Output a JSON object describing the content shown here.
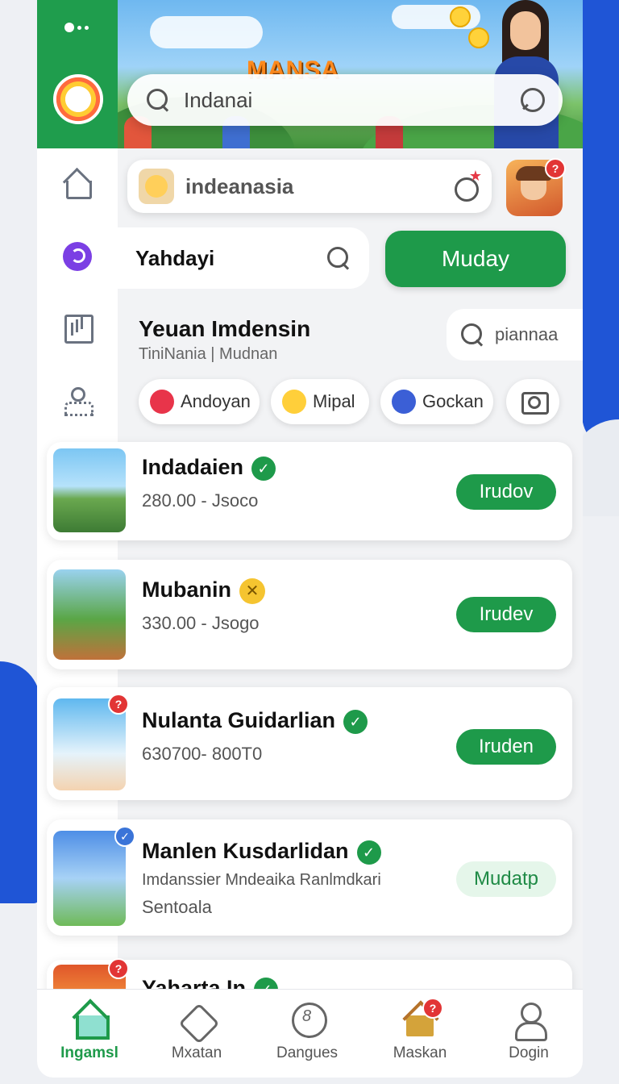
{
  "banner": {
    "title": "MANSA"
  },
  "search": {
    "main_text": "Indanai"
  },
  "featured": {
    "label": "indeanasia",
    "avatar_badge": "?"
  },
  "filter": {
    "label": "Yahdayi",
    "button": "Muday"
  },
  "section": {
    "title": "Yeuan Imdensin",
    "subtitle": "TiniNania | Mudnan",
    "search_text": "piannaa"
  },
  "chips": [
    {
      "label": "Andoyan"
    },
    {
      "label": "Mipal"
    },
    {
      "label": "Gockan"
    }
  ],
  "cards": [
    {
      "name": "Indadaien",
      "meta": "280.00 - Jsoco",
      "action": "Irudov",
      "status": "verified"
    },
    {
      "name": "Mubanin",
      "meta": "330.00 - Jsogo",
      "action": "Irudev",
      "status": "pending"
    },
    {
      "name": "Nulanta Guidarlian",
      "meta": "630700- 800T0",
      "action": "Iruden",
      "status": "verified",
      "badge": "?"
    },
    {
      "name": "Manlen Kusdarlidan",
      "meta": "Imdanssier Mndeaika Ranlmdkari",
      "meta2": "Sentoala",
      "action": "Mudatp",
      "status": "verified"
    },
    {
      "name": "Yaharta In",
      "status": "verified",
      "badge": "?"
    }
  ],
  "bottom_nav": [
    {
      "label": "Ingamsl",
      "active": true
    },
    {
      "label": "Mxatan"
    },
    {
      "label": "Dangues"
    },
    {
      "label": "Maskan",
      "badge": "?"
    },
    {
      "label": "Dogin"
    }
  ],
  "colors": {
    "accent": "#1e9a4a",
    "brand_blue": "#1f55d6",
    "badge": "#e23535"
  },
  "icons": {
    "search": "search-icon",
    "chat": "chat-icon",
    "home": "home-icon",
    "profile": "user-icon",
    "camera": "camera-icon",
    "verified": "check-icon"
  }
}
